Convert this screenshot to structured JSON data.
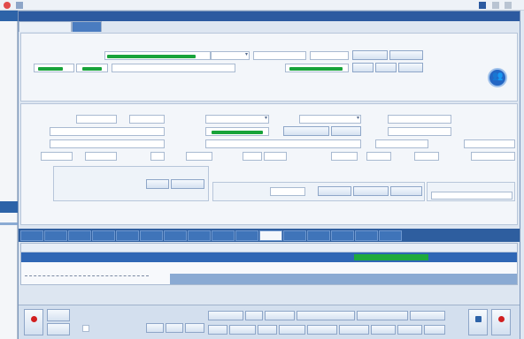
{
  "app": {
    "window_title": "",
    "dialog_title": ""
  },
  "tabs_top": [
    "",
    ""
  ],
  "tabs_mid": [
    "",
    "",
    "",
    "",
    "",
    "",
    "",
    "",
    "",
    "",
    "",
    "",
    "",
    "",
    "",
    ""
  ],
  "tabs_mid_active": 10,
  "grid": {
    "headers": [
      "",
      "",
      "",
      ""
    ],
    "row": [
      "",
      "",
      "",
      ""
    ]
  },
  "colors": {
    "accent": "#2c5aa0",
    "tab_bar": "#2e5e9f",
    "selected_row": "#2f67b5",
    "progress_green": "#18a33a",
    "record_red": "#d11f1f"
  },
  "icons": [
    "minimize-icon",
    "maximize-icon",
    "close-icon",
    "users-icon",
    "record-icon",
    "dropdown-icon"
  ]
}
